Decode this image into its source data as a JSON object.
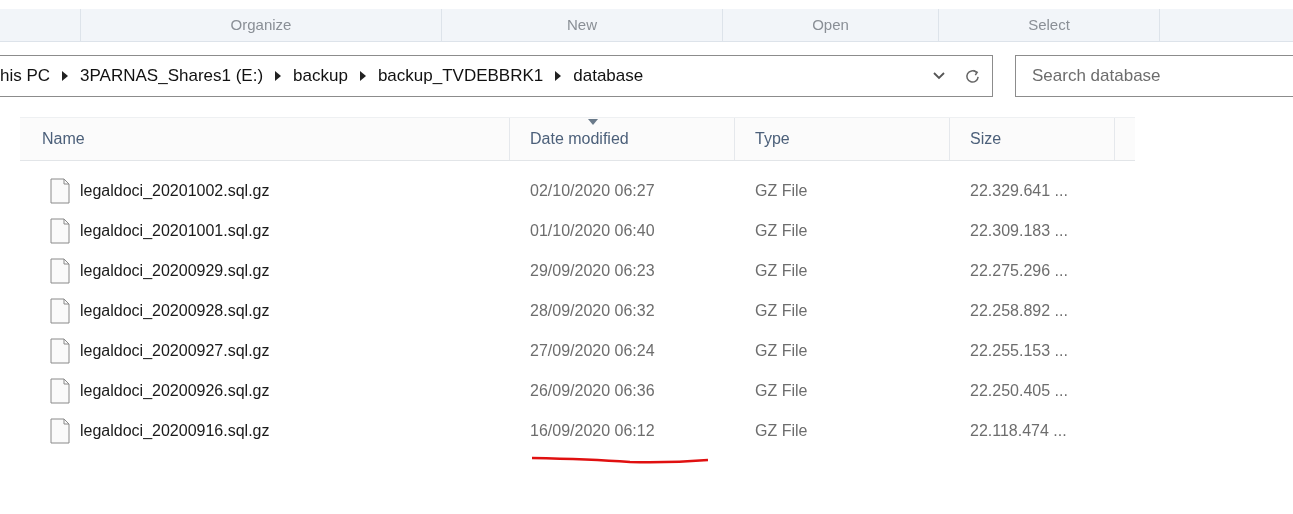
{
  "ribbon": {
    "groups": [
      "Organize",
      "New",
      "Open",
      "Select"
    ]
  },
  "address_bar": {
    "crumbs": [
      "his PC",
      "3PARNAS_Shares1 (E:)",
      "backup",
      "backup_TVDEBBRK1",
      "database"
    ]
  },
  "search": {
    "placeholder": "Search database"
  },
  "columns": [
    {
      "label": "Name",
      "sorted": false
    },
    {
      "label": "Date modified",
      "sorted": true
    },
    {
      "label": "Type",
      "sorted": false
    },
    {
      "label": "Size",
      "sorted": false
    }
  ],
  "rows": [
    {
      "name": "legaldoci_20201002.sql.gz",
      "date": "02/10/2020 06:27",
      "type": "GZ File",
      "size": "22.329.641 ...",
      "underlined": false
    },
    {
      "name": "legaldoci_20201001.sql.gz",
      "date": "01/10/2020 06:40",
      "type": "GZ File",
      "size": "22.309.183 ...",
      "underlined": false
    },
    {
      "name": "legaldoci_20200929.sql.gz",
      "date": "29/09/2020 06:23",
      "type": "GZ File",
      "size": "22.275.296 ...",
      "underlined": false
    },
    {
      "name": "legaldoci_20200928.sql.gz",
      "date": "28/09/2020 06:32",
      "type": "GZ File",
      "size": "22.258.892 ...",
      "underlined": false
    },
    {
      "name": "legaldoci_20200927.sql.gz",
      "date": "27/09/2020 06:24",
      "type": "GZ File",
      "size": "22.255.153 ...",
      "underlined": false
    },
    {
      "name": "legaldoci_20200926.sql.gz",
      "date": "26/09/2020 06:36",
      "type": "GZ File",
      "size": "22.250.405 ...",
      "underlined": false
    },
    {
      "name": "legaldoci_20200916.sql.gz",
      "date": "16/09/2020 06:12",
      "type": "GZ File",
      "size": "22.118.474 ...",
      "underlined": true
    }
  ]
}
